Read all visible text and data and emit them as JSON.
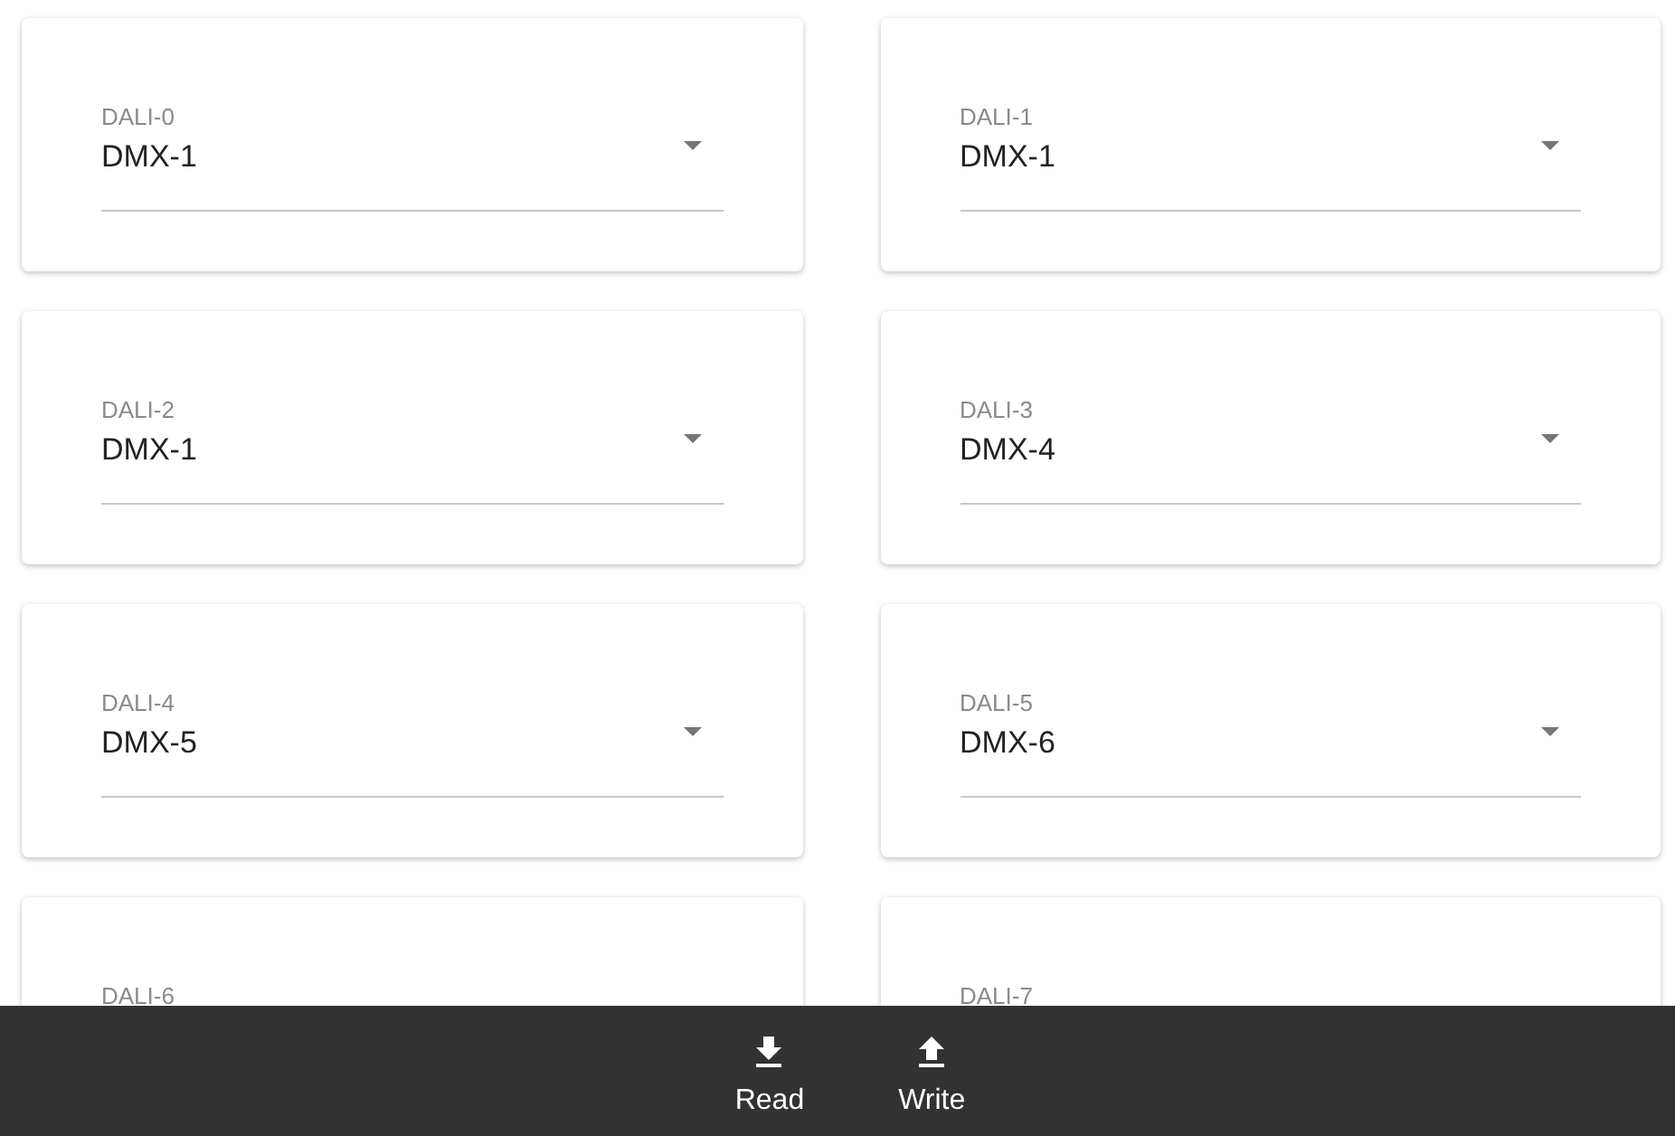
{
  "selects": [
    {
      "label": "DALI-0",
      "value": "DMX-1"
    },
    {
      "label": "DALI-1",
      "value": "DMX-1"
    },
    {
      "label": "DALI-2",
      "value": "DMX-1"
    },
    {
      "label": "DALI-3",
      "value": "DMX-4"
    },
    {
      "label": "DALI-4",
      "value": "DMX-5"
    },
    {
      "label": "DALI-5",
      "value": "DMX-6"
    },
    {
      "label": "DALI-6"
    },
    {
      "label": "DALI-7"
    }
  ],
  "bottom_bar": {
    "actions": [
      {
        "kind": "read",
        "label": "Read"
      },
      {
        "kind": "write",
        "label": "Write"
      }
    ]
  }
}
